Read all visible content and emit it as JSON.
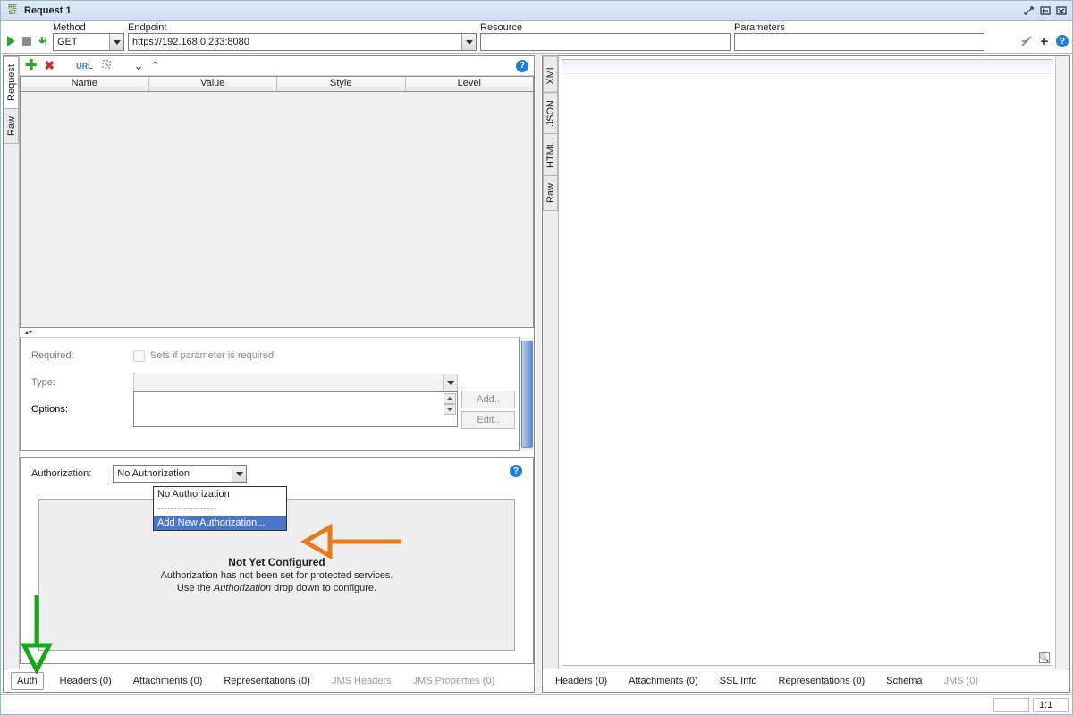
{
  "titlebar": {
    "title": "Request 1"
  },
  "toolbar": {
    "method_label": "Method",
    "method_value": "GET",
    "endpoint_label": "Endpoint",
    "endpoint_value": "https://192.168.0.233:8080",
    "resource_label": "Resource",
    "resource_value": "",
    "parameters_label": "Parameters",
    "parameters_value": ""
  },
  "left": {
    "vtabs": {
      "request": "Request",
      "raw": "Raw"
    },
    "param_cols": {
      "name": "Name",
      "value": "Value",
      "style": "Style",
      "level": "Level"
    },
    "props": {
      "required_label": "Required:",
      "required_chk": "Sets if parameter is required",
      "type_label": "Type:",
      "options_label": "Options:",
      "btn_add": "Add..",
      "btn_edit": "Edit.."
    },
    "auth": {
      "label": "Authorization:",
      "selected": "No Authorization",
      "opt_none": "No Authorization",
      "opt_sep": "------------------",
      "opt_add": "Add New Authorization...",
      "h": "Not Yet Configured",
      "l1": "Authorization has not been set for protected services.",
      "l2a": "Use the ",
      "l2b": "Authorization",
      "l2c": " drop down to configure."
    },
    "tabs": {
      "auth": "Auth",
      "headers": "Headers (0)",
      "attachments": "Attachments (0)",
      "representations": "Representations (0)",
      "jms_headers": "JMS Headers",
      "jms_props": "JMS Properties (0)"
    }
  },
  "right": {
    "vtabs": {
      "xml": "XML",
      "json": "JSON",
      "html": "HTML",
      "raw": "Raw"
    },
    "tabs": {
      "headers": "Headers (0)",
      "attachments": "Attachments (0)",
      "ssl": "SSL Info",
      "representations": "Representations (0)",
      "schema": "Schema",
      "jms": "JMS (0)"
    }
  },
  "status": {
    "ratio": "1:1"
  }
}
